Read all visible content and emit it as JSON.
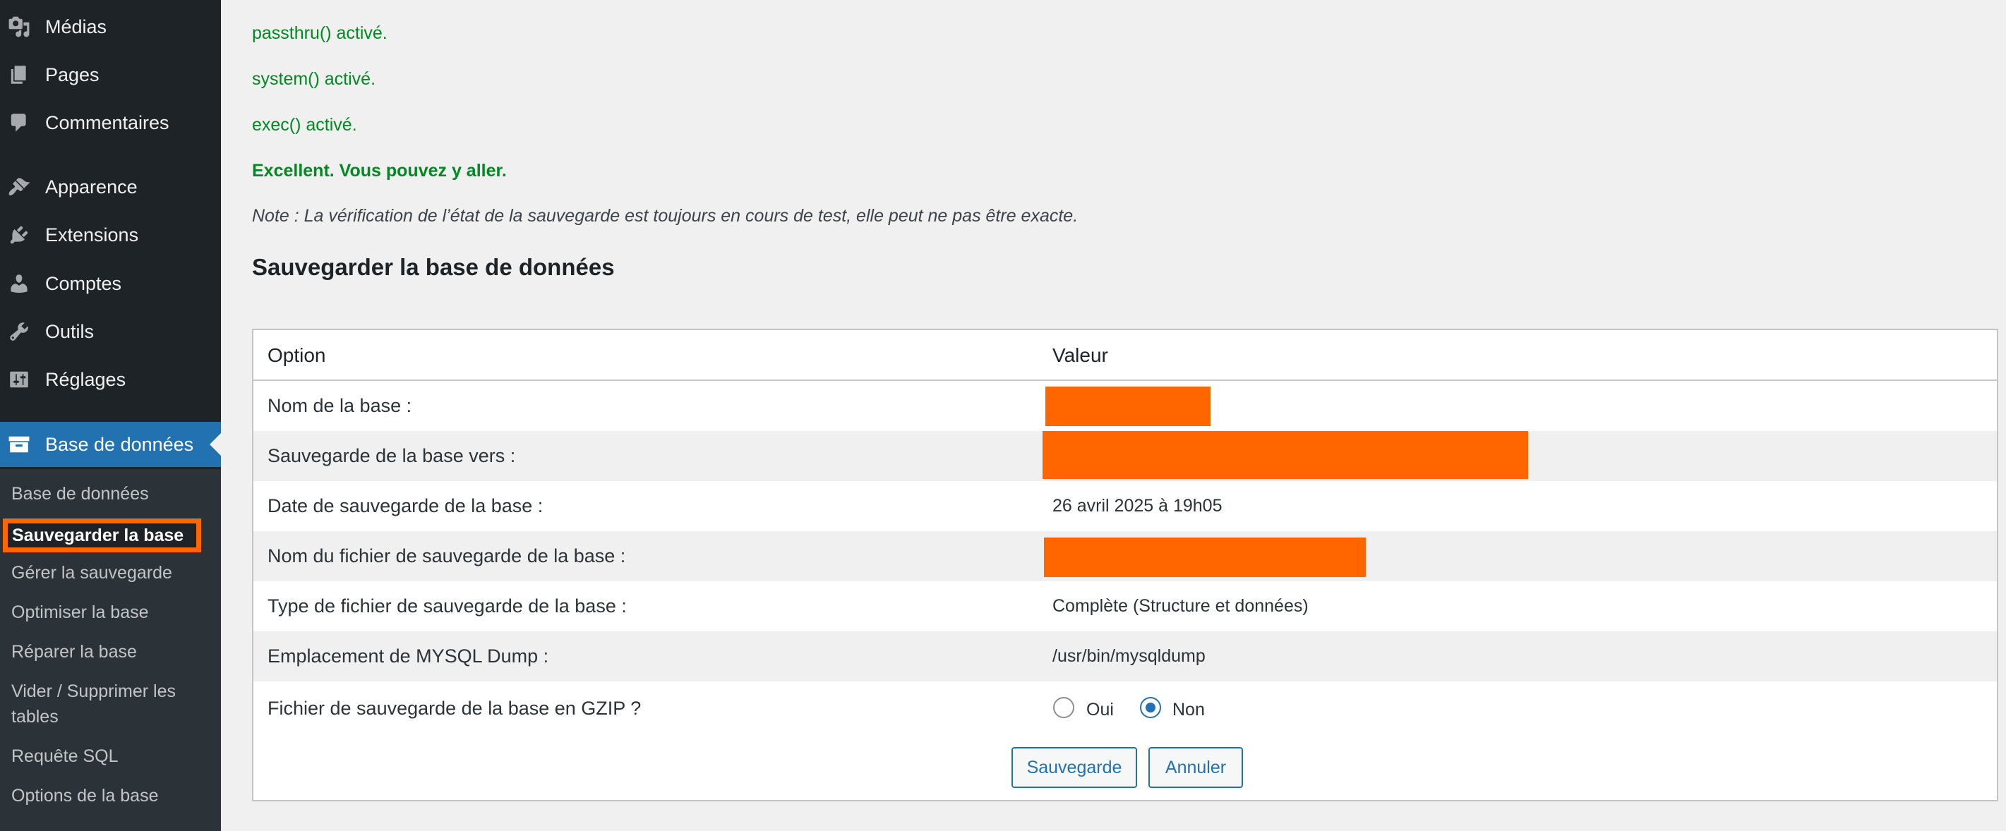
{
  "sidebar": {
    "menu": [
      {
        "label": "Médias",
        "icon": "media-icon"
      },
      {
        "label": "Pages",
        "icon": "pages-icon"
      },
      {
        "label": "Commentaires",
        "icon": "comments-icon"
      },
      {
        "label": "Apparence",
        "icon": "appearance-icon"
      },
      {
        "label": "Extensions",
        "icon": "plugins-icon"
      },
      {
        "label": "Comptes",
        "icon": "users-icon"
      },
      {
        "label": "Outils",
        "icon": "tools-icon"
      },
      {
        "label": "Réglages",
        "icon": "settings-icon"
      },
      {
        "label": "Base de données",
        "icon": "database-icon"
      }
    ],
    "submenu": [
      "Base de données",
      "Sauvegarder la base",
      "Gérer la sauvegarde",
      "Optimiser la base",
      "Réparer la base",
      "Vider / Supprimer les",
      "tables",
      "Requête SQL",
      "Options de la base"
    ]
  },
  "main": {
    "status": [
      "passthru() activé.",
      "system() activé.",
      "exec() activé.",
      "Excellent. Vous pouvez y aller."
    ],
    "note": "Note : La vérification de l’état de la sauvegarde est toujours en cours de test, elle peut ne pas être exacte.",
    "section_title": "Sauvegarder la base de données",
    "table": {
      "headers": [
        "Option",
        "Valeur"
      ],
      "rows": [
        {
          "label": "Nom de la base :",
          "value": ""
        },
        {
          "label": "Sauvegarde de la base vers :",
          "value": ""
        },
        {
          "label": "Date de sauvegarde de la base :",
          "value": "26 avril 2025 à 19h05"
        },
        {
          "label": "Nom du fichier de sauvegarde de la base :",
          "value": ""
        },
        {
          "label": "Type de fichier de sauvegarde de la base :",
          "value": "Complète (Structure et données)"
        },
        {
          "label": "Emplacement de MYSQL Dump :",
          "value": "/usr/bin/mysqldump"
        },
        {
          "label": "Fichier de sauvegarde de la base en GZIP ?",
          "value": ""
        }
      ],
      "gzip_options": [
        {
          "label": "Oui",
          "checked": false
        },
        {
          "label": "Non",
          "checked": true
        }
      ]
    },
    "buttons": {
      "save": "Sauvegarde",
      "cancel": "Annuler"
    }
  },
  "colors": {
    "sidebar_bg": "#1d2327",
    "submenu_bg": "#2c3338",
    "accent": "#2271b1",
    "success": "#008a20",
    "highlight": "#ff6600"
  }
}
